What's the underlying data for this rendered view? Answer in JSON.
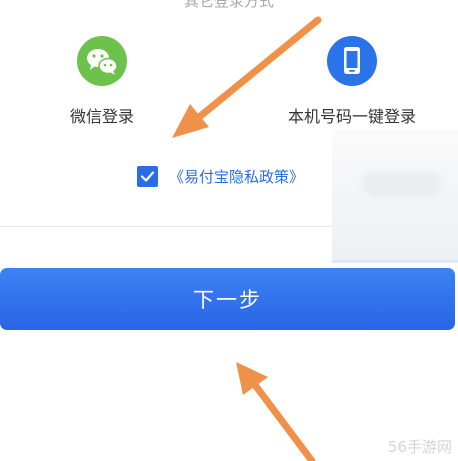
{
  "header": {
    "other_login_title": "其它登录方式"
  },
  "login_options": [
    {
      "label": "微信登录",
      "icon": "wechat-icon",
      "color": "#6cc24a"
    },
    {
      "label": "本机号码一键登录",
      "icon": "phone-icon",
      "color": "#2b73e8"
    }
  ],
  "agreement": {
    "checked": true,
    "text": "《易付宝隐私政策》"
  },
  "primary_action": {
    "label": "下一步"
  },
  "annotations": {
    "arrow_color": "#f0914a"
  },
  "watermark": "56手游网"
}
